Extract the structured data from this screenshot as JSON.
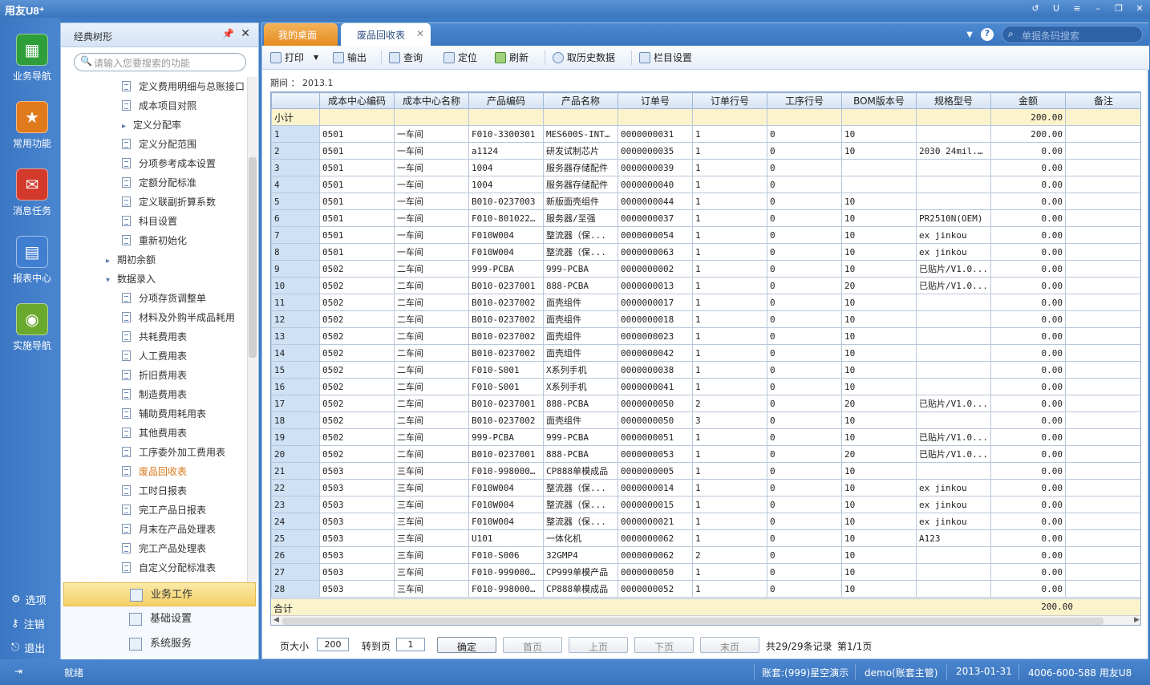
{
  "titlebar": {
    "logo": "用友U8⁺"
  },
  "nav": {
    "items": [
      {
        "label": "业务导航",
        "icon": "business-nav-icon",
        "color": "#2e9d3a"
      },
      {
        "label": "常用功能",
        "icon": "star-icon",
        "color": "#e07a1c"
      },
      {
        "label": "消息任务",
        "icon": "message-icon",
        "color": "#d33a2c"
      },
      {
        "label": "报表中心",
        "icon": "report-icon",
        "color": "#3f7ed1"
      },
      {
        "label": "实施导航",
        "icon": "compass-icon",
        "color": "#6aa82e"
      }
    ],
    "bottom": [
      {
        "label": "选项",
        "glyph": "⚙"
      },
      {
        "label": "注销",
        "glyph": "⚷"
      },
      {
        "label": "退出",
        "glyph": "⎋"
      }
    ]
  },
  "tree": {
    "title": "经典树形",
    "search_placeholder": "请输入您要搜索的功能",
    "items": [
      {
        "label": "定义费用明细与总账接口",
        "type": "doc",
        "indent": 2
      },
      {
        "label": "成本项目对照",
        "type": "doc",
        "indent": 2
      },
      {
        "label": "定义分配率",
        "type": "folder",
        "indent": 2
      },
      {
        "label": "定义分配范围",
        "type": "doc",
        "indent": 2
      },
      {
        "label": "分项参考成本设置",
        "type": "doc",
        "indent": 2
      },
      {
        "label": "定额分配标准",
        "type": "doc",
        "indent": 2
      },
      {
        "label": "定义联副折算系数",
        "type": "doc",
        "indent": 2
      },
      {
        "label": "科目设置",
        "type": "doc",
        "indent": 2
      },
      {
        "label": "重新初始化",
        "type": "doc",
        "indent": 2
      },
      {
        "label": "期初余额",
        "type": "folder",
        "indent": 1
      },
      {
        "label": "数据录入",
        "type": "open",
        "indent": 1
      },
      {
        "label": "分项存货调整单",
        "type": "doc",
        "indent": 2
      },
      {
        "label": "材料及外购半成品耗用",
        "type": "doc",
        "indent": 2
      },
      {
        "label": "共耗费用表",
        "type": "doc",
        "indent": 2
      },
      {
        "label": "人工费用表",
        "type": "doc",
        "indent": 2
      },
      {
        "label": "折旧费用表",
        "type": "doc",
        "indent": 2
      },
      {
        "label": "制造费用表",
        "type": "doc",
        "indent": 2
      },
      {
        "label": "辅助费用耗用表",
        "type": "doc",
        "indent": 2
      },
      {
        "label": "其他费用表",
        "type": "doc",
        "indent": 2
      },
      {
        "label": "工序委外加工费用表",
        "type": "doc",
        "indent": 2
      },
      {
        "label": "废品回收表",
        "type": "doc",
        "indent": 2,
        "active": true
      },
      {
        "label": "工时日报表",
        "type": "doc",
        "indent": 2
      },
      {
        "label": "完工产品日报表",
        "type": "doc",
        "indent": 2
      },
      {
        "label": "月末在产品处理表",
        "type": "doc",
        "indent": 2
      },
      {
        "label": "完工产品处理表",
        "type": "doc",
        "indent": 2
      },
      {
        "label": "自定义分配标准表",
        "type": "doc",
        "indent": 2
      }
    ],
    "bottom_tabs": [
      {
        "label": "业务工作",
        "selected": true
      },
      {
        "label": "基础设置",
        "selected": false
      },
      {
        "label": "系统服务",
        "selected": false
      }
    ]
  },
  "tabs": {
    "desktop": "我的桌面",
    "current": "废品回收表",
    "barcode_placeholder": "单据条码搜索"
  },
  "toolbar": {
    "print": "打印",
    "export": "输出",
    "query": "查询",
    "locate": "定位",
    "refresh": "刷新",
    "history": "取历史数据",
    "columns": "栏目设置"
  },
  "period": "期间 ： 2013.1",
  "grid": {
    "columns": [
      "",
      "成本中心编码",
      "成本中心名称",
      "产品编码",
      "产品名称",
      "订单号",
      "订单行号",
      "工序行号",
      "BOM版本号",
      "规格型号",
      "金额",
      "备注"
    ],
    "subtotal": {
      "label": "小计",
      "amount": "200.00"
    },
    "rows": [
      [
        "1",
        "0501",
        "一车间",
        "F010-3300301",
        "MES600S-INT...",
        "0000000031",
        "1",
        "0",
        "10",
        "",
        "200.00",
        ""
      ],
      [
        "2",
        "0501",
        "一车间",
        "a1124",
        "研发试制芯片",
        "0000000035",
        "1",
        "0",
        "10",
        "2030 24mil...",
        "0.00",
        ""
      ],
      [
        "3",
        "0501",
        "一车间",
        "1004",
        "服务器存储配件",
        "0000000039",
        "1",
        "0",
        "",
        "",
        "0.00",
        ""
      ],
      [
        "4",
        "0501",
        "一车间",
        "1004",
        "服务器存储配件",
        "0000000040",
        "1",
        "0",
        "",
        "",
        "0.00",
        ""
      ],
      [
        "5",
        "0501",
        "一车间",
        "B010-0237003",
        "新版面壳组件",
        "0000000044",
        "1",
        "0",
        "10",
        "",
        "0.00",
        ""
      ],
      [
        "6",
        "0501",
        "一车间",
        "F010-80102251",
        "服务器/至强",
        "0000000037",
        "1",
        "0",
        "10",
        "PR2510N(OEM)",
        "0.00",
        ""
      ],
      [
        "7",
        "0501",
        "一车间",
        "F010W004",
        "整流器（保...",
        "0000000054",
        "1",
        "0",
        "10",
        "ex jinkou",
        "0.00",
        ""
      ],
      [
        "8",
        "0501",
        "一车间",
        "F010W004",
        "整流器（保...",
        "0000000063",
        "1",
        "0",
        "10",
        "ex jinkou",
        "0.00",
        ""
      ],
      [
        "9",
        "0502",
        "二车间",
        "999-PCBA",
        "999-PCBA",
        "0000000002",
        "1",
        "0",
        "10",
        "已贴片/V1.0...",
        "0.00",
        ""
      ],
      [
        "10",
        "0502",
        "二车间",
        "B010-0237001",
        "888-PCBA",
        "0000000013",
        "1",
        "0",
        "20",
        "已贴片/V1.0...",
        "0.00",
        ""
      ],
      [
        "11",
        "0502",
        "二车间",
        "B010-0237002",
        "面壳组件",
        "0000000017",
        "1",
        "0",
        "10",
        "",
        "0.00",
        ""
      ],
      [
        "12",
        "0502",
        "二车间",
        "B010-0237002",
        "面壳组件",
        "0000000018",
        "1",
        "0",
        "10",
        "",
        "0.00",
        ""
      ],
      [
        "13",
        "0502",
        "二车间",
        "B010-0237002",
        "面壳组件",
        "0000000023",
        "1",
        "0",
        "10",
        "",
        "0.00",
        ""
      ],
      [
        "14",
        "0502",
        "二车间",
        "B010-0237002",
        "面壳组件",
        "0000000042",
        "1",
        "0",
        "10",
        "",
        "0.00",
        ""
      ],
      [
        "15",
        "0502",
        "二车间",
        "F010-S001",
        "X系列手机",
        "0000000038",
        "1",
        "0",
        "10",
        "",
        "0.00",
        ""
      ],
      [
        "16",
        "0502",
        "二车间",
        "F010-S001",
        "X系列手机",
        "0000000041",
        "1",
        "0",
        "10",
        "",
        "0.00",
        ""
      ],
      [
        "17",
        "0502",
        "二车间",
        "B010-0237001",
        "888-PCBA",
        "0000000050",
        "2",
        "0",
        "20",
        "已贴片/V1.0...",
        "0.00",
        ""
      ],
      [
        "18",
        "0502",
        "二车间",
        "B010-0237002",
        "面壳组件",
        "0000000050",
        "3",
        "0",
        "10",
        "",
        "0.00",
        ""
      ],
      [
        "19",
        "0502",
        "二车间",
        "999-PCBA",
        "999-PCBA",
        "0000000051",
        "1",
        "0",
        "10",
        "已贴片/V1.0...",
        "0.00",
        ""
      ],
      [
        "20",
        "0502",
        "二车间",
        "B010-0237001",
        "888-PCBA",
        "0000000053",
        "1",
        "0",
        "20",
        "已贴片/V1.0...",
        "0.00",
        ""
      ],
      [
        "21",
        "0503",
        "三车间",
        "F010-998000...",
        "CP888单模成品",
        "0000000005",
        "1",
        "0",
        "10",
        "",
        "0.00",
        ""
      ],
      [
        "22",
        "0503",
        "三车间",
        "F010W004",
        "整流器（保...",
        "0000000014",
        "1",
        "0",
        "10",
        "ex jinkou",
        "0.00",
        ""
      ],
      [
        "23",
        "0503",
        "三车间",
        "F010W004",
        "整流器（保...",
        "0000000015",
        "1",
        "0",
        "10",
        "ex jinkou",
        "0.00",
        ""
      ],
      [
        "24",
        "0503",
        "三车间",
        "F010W004",
        "整流器（保...",
        "0000000021",
        "1",
        "0",
        "10",
        "ex jinkou",
        "0.00",
        ""
      ],
      [
        "25",
        "0503",
        "三车间",
        "U101",
        "一体化机",
        "0000000062",
        "1",
        "0",
        "10",
        "A123",
        "0.00",
        ""
      ],
      [
        "26",
        "0503",
        "三车间",
        "F010-S006",
        "32GMP4",
        "0000000062",
        "2",
        "0",
        "10",
        "",
        "0.00",
        ""
      ],
      [
        "27",
        "0503",
        "三车间",
        "F010-999000...",
        "CP999单模产品",
        "0000000050",
        "1",
        "0",
        "10",
        "",
        "0.00",
        ""
      ],
      [
        "28",
        "0503",
        "三车间",
        "F010-998000...",
        "CP888单模成品",
        "0000000052",
        "1",
        "0",
        "10",
        "",
        "0.00",
        ""
      ]
    ],
    "total": {
      "label": "合计",
      "amount": "200.00"
    }
  },
  "pager": {
    "page_size_label": "页大小",
    "page_size": "200",
    "goto_label": "转到页",
    "goto_value": "1",
    "confirm": "确定",
    "first": "首页",
    "prev": "上页",
    "next": "下页",
    "last": "末页",
    "summary": "共29/29条记录",
    "page_info": "第1/1页"
  },
  "status": {
    "ready": "就绪",
    "account": "账套:(999)星空演示",
    "user": "demo(账套主管)",
    "date": "2013-01-31",
    "phone": "4006-600-588 用友U8"
  }
}
